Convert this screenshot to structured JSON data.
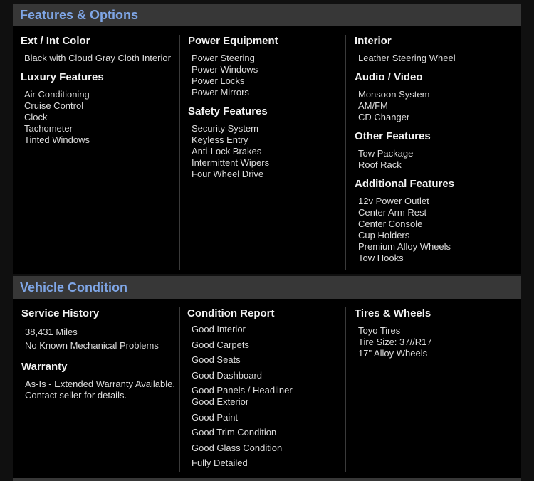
{
  "features": {
    "title": "Features & Options",
    "columns": [
      [
        {
          "heading": "Ext / Int Color",
          "items": [
            "Black with Cloud Gray Cloth Interior"
          ]
        },
        {
          "heading": "Luxury Features",
          "items": [
            "Air Conditioning",
            "Cruise Control",
            "Clock",
            "Tachometer",
            "Tinted Windows"
          ]
        }
      ],
      [
        {
          "heading": "Power Equipment",
          "items": [
            "Power Steering",
            "Power Windows",
            "Power Locks",
            "Power Mirrors"
          ]
        },
        {
          "heading": "Safety Features",
          "items": [
            "Security System",
            "Keyless Entry",
            "Anti-Lock Brakes",
            "Intermittent Wipers",
            "Four Wheel Drive"
          ]
        }
      ],
      [
        {
          "heading": "Interior",
          "items": [
            "Leather Steering Wheel"
          ]
        },
        {
          "heading": "Audio / Video",
          "items": [
            "Monsoon System",
            "AM/FM",
            "CD Changer"
          ]
        },
        {
          "heading": "Other Features",
          "items": [
            "Tow Package",
            "Roof Rack"
          ]
        },
        {
          "heading": "Additional Features",
          "items": [
            "12v Power Outlet",
            "Center Arm Rest",
            "Center Console",
            "Cup Holders",
            "Premium Alloy Wheels",
            "Tow Hooks"
          ]
        }
      ]
    ]
  },
  "condition": {
    "title": "Vehicle Condition",
    "service_history": {
      "heading": "Service History",
      "items": [
        "38,431 Miles",
        "No Known Mechanical Problems"
      ]
    },
    "warranty": {
      "heading": "Warranty",
      "items": [
        "As-Is - Extended Warranty Available.",
        "Contact seller for details."
      ]
    },
    "condition_report": {
      "heading": "Condition Report",
      "items": [
        "Good Interior",
        "Good Carpets",
        "Good Seats",
        "Good Dashboard",
        "Good Panels / Headliner",
        "Good Exterior",
        "Good Paint",
        "Good Trim Condition",
        "Good Glass Condition",
        "Fully Detailed"
      ]
    },
    "tires": {
      "heading": "Tires & Wheels",
      "items": [
        "Toyo Tires",
        "Tire Size: 37//R17",
        "17\" Alloy Wheels"
      ]
    }
  }
}
